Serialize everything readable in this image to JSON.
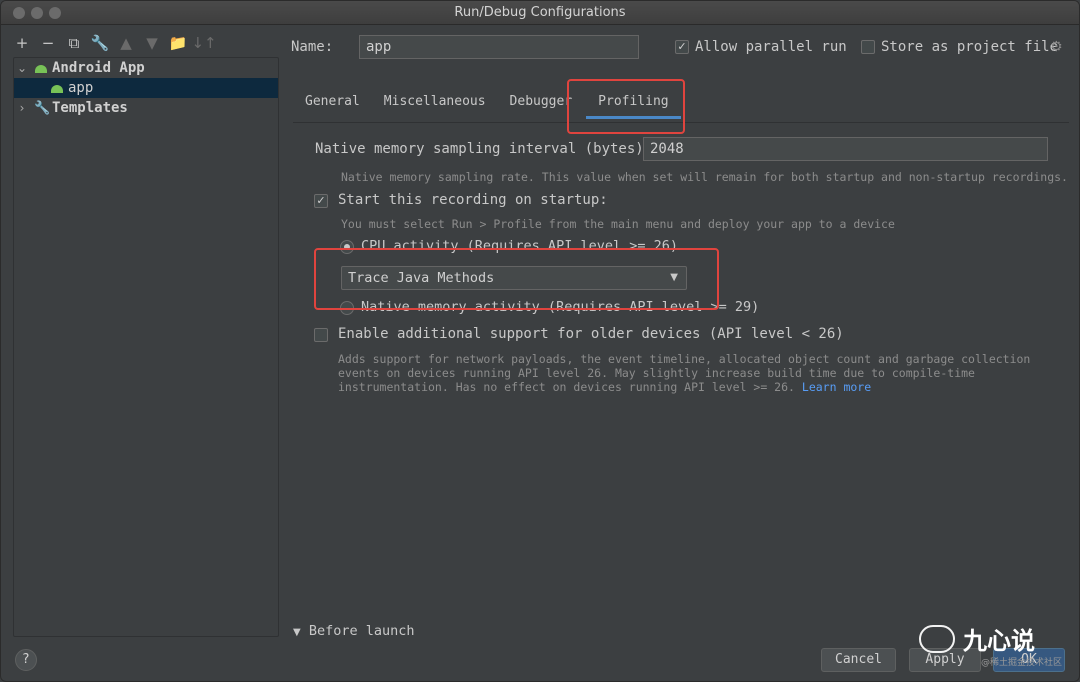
{
  "window": {
    "title": "Run/Debug Configurations"
  },
  "toolbar": {
    "add": "+",
    "remove": "−",
    "copy": "⧉",
    "wrench": "🔧",
    "move_up": "▲",
    "move_down": "▼",
    "new_folder": "📁",
    "sort": "↓↑"
  },
  "tree": {
    "items": [
      {
        "label": "Android App",
        "expanded": true
      },
      {
        "label": "app",
        "selected": true
      },
      {
        "label": "Templates",
        "expanded": false
      }
    ]
  },
  "form": {
    "name_label": "Name:",
    "name_value": "app",
    "allow_parallel_label": "Allow parallel run",
    "allow_parallel_checked": true,
    "store_project_label": "Store as project file",
    "store_project_checked": false
  },
  "tabs": [
    "General",
    "Miscellaneous",
    "Debugger",
    "Profiling"
  ],
  "active_tab": "Profiling",
  "profiling": {
    "sampling_label": "Native memory sampling interval (bytes):",
    "sampling_value": "2048",
    "sampling_hint": "Native memory sampling rate. This value when set will remain for both startup and non-startup recordings.",
    "start_recording_label": "Start this recording on startup:",
    "start_recording_checked": true,
    "start_hint": "You must select Run > Profile from the main menu and deploy your app to a device",
    "cpu_label": "CPU activity (Requires API level >= 26)",
    "cpu_selected": true,
    "trace_value": "Trace Java Methods",
    "native_label": "Native memory activity (Requires API level >= 29)",
    "native_selected": false,
    "older_label": "Enable additional support for older devices (API level < 26)",
    "older_checked": false,
    "older_hint_1": "Adds support for network payloads, the event timeline, allocated object count and garbage collection",
    "older_hint_2": "events on devices running API level 26. May slightly increase build time due to compile-time",
    "older_hint_3": "instrumentation. Has no effect on devices running API level >= 26.",
    "learn_more": "Learn more"
  },
  "bottom": {
    "before_launch": "Before launch",
    "help": "?",
    "cancel": "Cancel",
    "apply": "Apply",
    "ok": "OK"
  },
  "watermark": {
    "title": "九心说",
    "sub": "@稀土掘金技术社区"
  },
  "colors": {
    "accent": "#4a88c7",
    "highlight": "#e0443e",
    "link": "#589df6",
    "android": "#78c257"
  }
}
